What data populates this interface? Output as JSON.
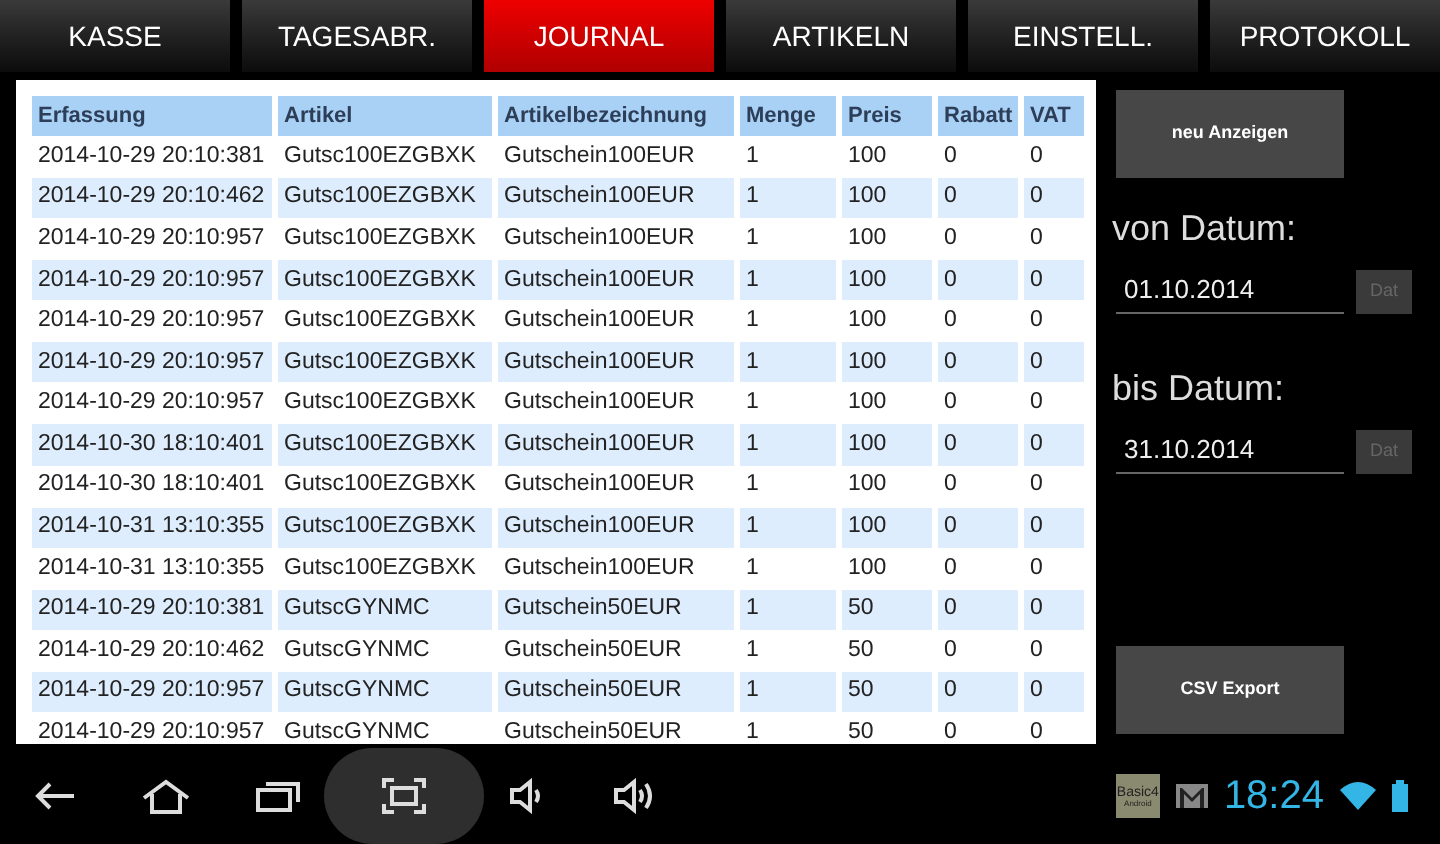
{
  "tabs": [
    {
      "label": "KASSE",
      "selected": false
    },
    {
      "label": "TAGESABR.",
      "selected": false
    },
    {
      "label": "JOURNAL",
      "selected": true
    },
    {
      "label": "ARTIKELN",
      "selected": false
    },
    {
      "label": "EINSTELL.",
      "selected": false
    },
    {
      "label": "PROTOKOLL",
      "selected": false
    }
  ],
  "table": {
    "columns": [
      "Erfassung",
      "Artikel",
      "Artikelbezeichnung",
      "Menge",
      "Preis",
      "Rabatt",
      "VAT"
    ],
    "rows": [
      [
        "2014-10-29 20:10:381",
        "Gutsc100EZGBXK",
        "Gutschein100EUR",
        "1",
        "100",
        "0",
        "0"
      ],
      [
        "2014-10-29 20:10:462",
        "Gutsc100EZGBXK",
        "Gutschein100EUR",
        "1",
        "100",
        "0",
        "0"
      ],
      [
        "2014-10-29 20:10:957",
        "Gutsc100EZGBXK",
        "Gutschein100EUR",
        "1",
        "100",
        "0",
        "0"
      ],
      [
        "2014-10-29 20:10:957",
        "Gutsc100EZGBXK",
        "Gutschein100EUR",
        "1",
        "100",
        "0",
        "0"
      ],
      [
        "2014-10-29 20:10:957",
        "Gutsc100EZGBXK",
        "Gutschein100EUR",
        "1",
        "100",
        "0",
        "0"
      ],
      [
        "2014-10-29 20:10:957",
        "Gutsc100EZGBXK",
        "Gutschein100EUR",
        "1",
        "100",
        "0",
        "0"
      ],
      [
        "2014-10-29 20:10:957",
        "Gutsc100EZGBXK",
        "Gutschein100EUR",
        "1",
        "100",
        "0",
        "0"
      ],
      [
        "2014-10-30 18:10:401",
        "Gutsc100EZGBXK",
        "Gutschein100EUR",
        "1",
        "100",
        "0",
        "0"
      ],
      [
        "2014-10-30 18:10:401",
        "Gutsc100EZGBXK",
        "Gutschein100EUR",
        "1",
        "100",
        "0",
        "0"
      ],
      [
        "2014-10-31 13:10:355",
        "Gutsc100EZGBXK",
        "Gutschein100EUR",
        "1",
        "100",
        "0",
        "0"
      ],
      [
        "2014-10-31 13:10:355",
        "Gutsc100EZGBXK",
        "Gutschein100EUR",
        "1",
        "100",
        "0",
        "0"
      ],
      [
        "2014-10-29 20:10:381",
        "GutscGYNMC",
        "Gutschein50EUR",
        "1",
        "50",
        "0",
        "0"
      ],
      [
        "2014-10-29 20:10:462",
        "GutscGYNMC",
        "Gutschein50EUR",
        "1",
        "50",
        "0",
        "0"
      ],
      [
        "2014-10-29 20:10:957",
        "GutscGYNMC",
        "Gutschein50EUR",
        "1",
        "50",
        "0",
        "0"
      ],
      [
        "2014-10-29 20:10:957",
        "GutscGYNMC",
        "Gutschein50EUR",
        "1",
        "50",
        "0",
        "0"
      ]
    ]
  },
  "refresh_button": "neu Anzeigen",
  "from": {
    "label": "von Datum:",
    "value": "01.10.2014",
    "button": "Dat"
  },
  "to": {
    "label": "bis Datum:",
    "value": "31.10.2014",
    "button": "Dat"
  },
  "export_button": "CSV Export",
  "status_bar": {
    "app_icon_lines": [
      "Basic4",
      "Android"
    ],
    "time": "18:24"
  }
}
